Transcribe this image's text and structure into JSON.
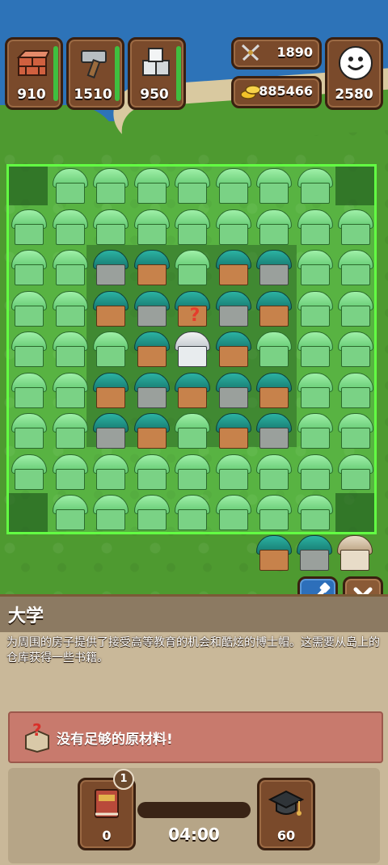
{
  "resources": {
    "brick": {
      "value": "910",
      "icon": "brick-icon"
    },
    "hammer": {
      "value": "1510",
      "icon": "hammer-icon"
    },
    "stone": {
      "value": "950",
      "icon": "stone-blocks-icon"
    }
  },
  "stats": {
    "swords": {
      "value": "1890",
      "icon": "crossed-swords-icon"
    },
    "coins": {
      "value": "885466",
      "icon": "gold-coins-icon"
    }
  },
  "happiness": {
    "value": "2580",
    "icon": "smiley-icon"
  },
  "buttons": {
    "pick": "dropper-icon",
    "close": "close-icon"
  },
  "panel": {
    "title": "大学",
    "description": "为周围的房子提供了接受高等教育的机会和酷炫的博士帽。这需要从岛上的仓库获得一些书籍。",
    "warning": "没有足够的原材料!"
  },
  "production": {
    "input": {
      "value": "0",
      "badge": "1",
      "icon": "book-icon"
    },
    "timer": "04:00",
    "output": {
      "value": "60",
      "icon": "graduation-cap-icon"
    },
    "progress": 0
  },
  "colors": {
    "grid_highlight": "#63ff43",
    "panel_bg": "#c9b899",
    "wood": "#7a4a2b"
  }
}
